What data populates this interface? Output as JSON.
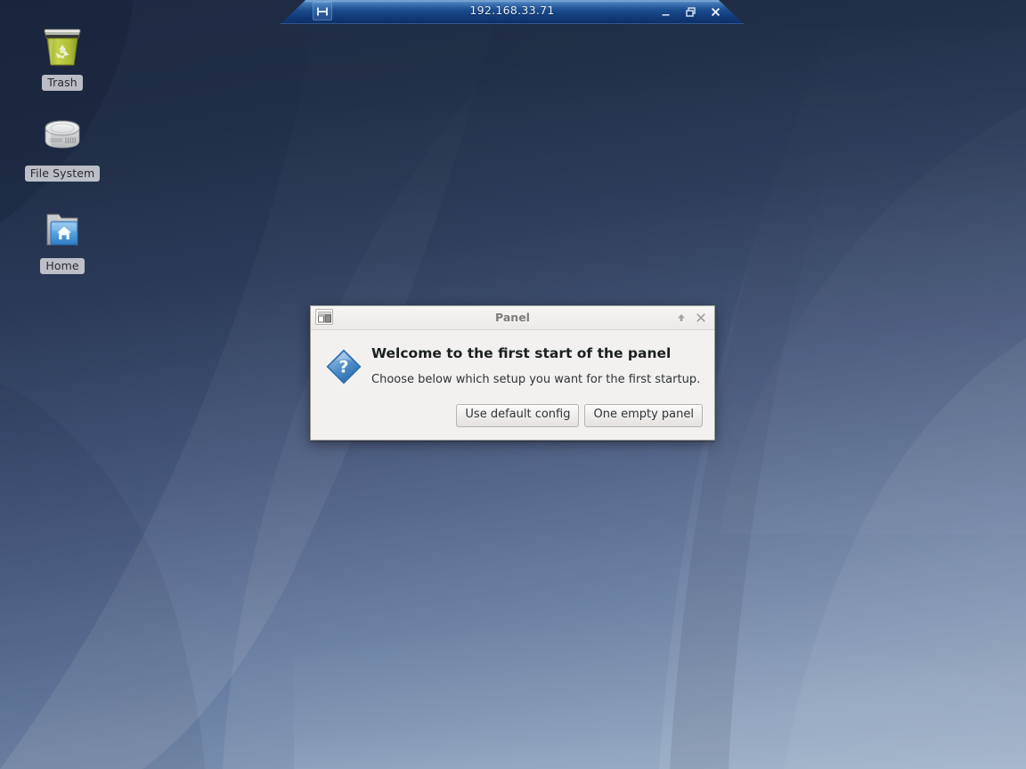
{
  "desktop": {
    "icons": [
      {
        "id": "trash",
        "label": "Trash",
        "icon": "trash-icon"
      },
      {
        "id": "filesystem",
        "label": "File System",
        "icon": "harddisk-icon"
      },
      {
        "id": "home",
        "label": "Home",
        "icon": "home-folder-icon"
      }
    ],
    "wallpaper_colors": {
      "top": "#1e2a42",
      "bottom": "#8b9fbb",
      "accent": "#7e93b2"
    }
  },
  "remote_window": {
    "title": "192.168.33.71",
    "app_icon": "remote-viewer-icon",
    "buttons": {
      "minimize": "–",
      "maximize": "❐",
      "close": "✕"
    },
    "titlebar_color": "#123a79"
  },
  "dialog": {
    "title": "Panel",
    "app_icon": "panel-window-icon",
    "titlebar_buttons": {
      "shade": "⬆",
      "close": "✕"
    },
    "icon": "question-diamond-icon",
    "heading": "Welcome to the first start of the panel",
    "message": "Choose below which setup you want for the first startup.",
    "buttons": [
      {
        "id": "use-default-config",
        "label": "Use default config"
      },
      {
        "id": "one-empty-panel",
        "label": "One empty panel"
      }
    ]
  }
}
